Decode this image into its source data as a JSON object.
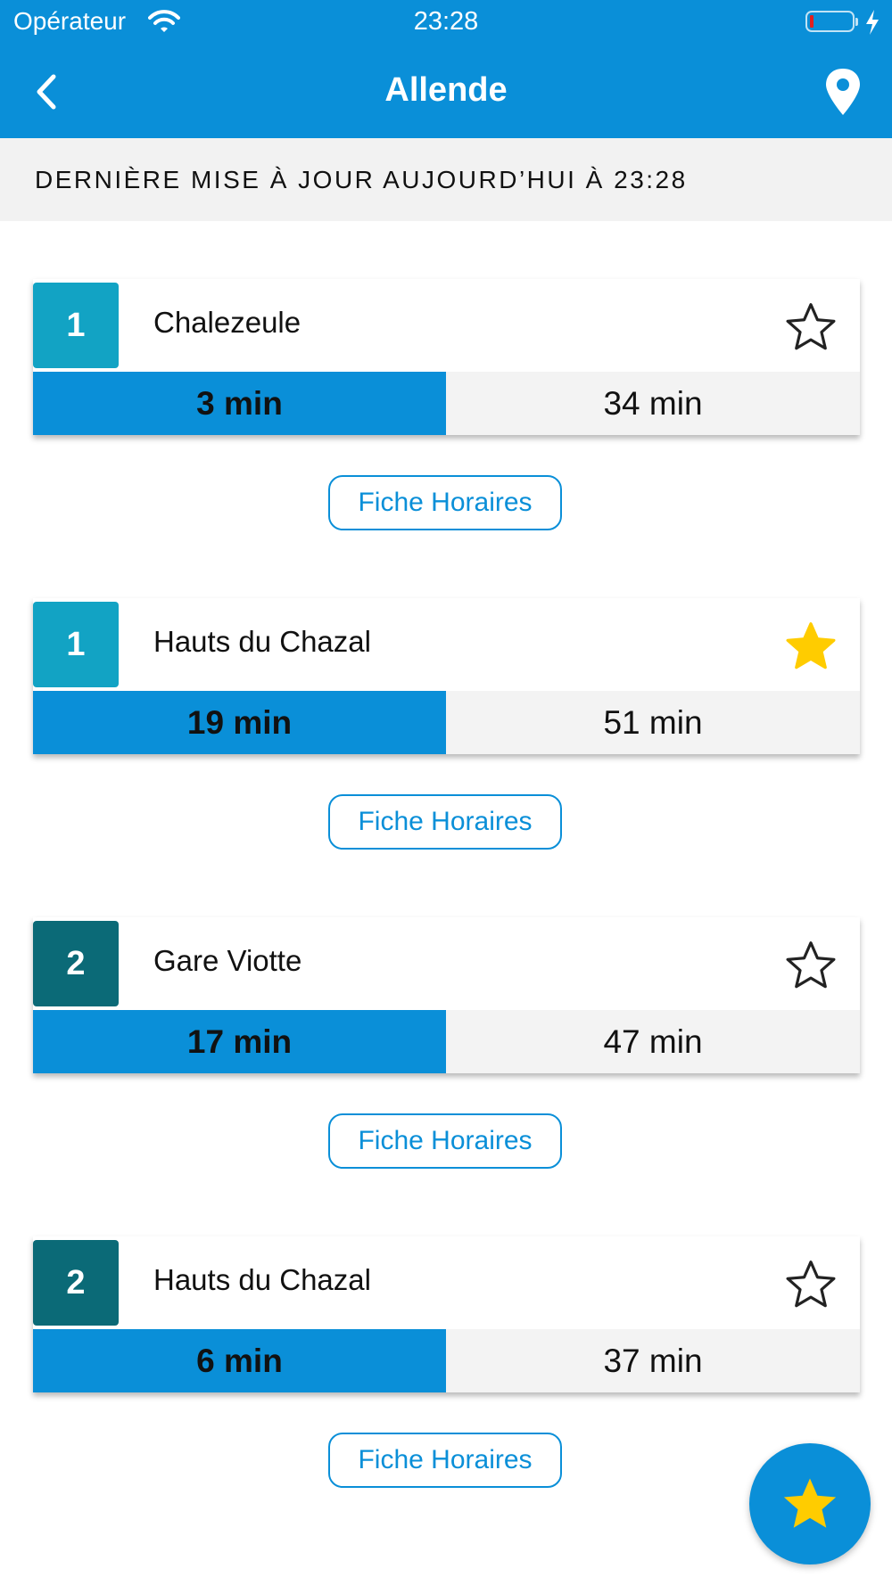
{
  "status_bar": {
    "carrier": "Opérateur",
    "time": "23:28"
  },
  "nav": {
    "title": "Allende",
    "back_icon": "chevron-left-icon",
    "map_icon": "map-pin-icon"
  },
  "last_update": "DERNIÈRE MISE À JOUR AUJOURD’HUI À 23:28",
  "departures": [
    {
      "line": "1",
      "line_color": "#12a3c4",
      "destination": "Chalezeule",
      "next": "3 min",
      "following": "34 min",
      "favorite": false,
      "button": "Fiche Horaires"
    },
    {
      "line": "1",
      "line_color": "#12a3c4",
      "destination": "Hauts du Chazal",
      "next": "19 min",
      "following": "51 min",
      "favorite": true,
      "button": "Fiche Horaires"
    },
    {
      "line": "2",
      "line_color": "#0b6a77",
      "destination": "Gare Viotte",
      "next": "17 min",
      "following": "47 min",
      "favorite": false,
      "button": "Fiche Horaires"
    },
    {
      "line": "2",
      "line_color": "#0b6a77",
      "destination": "Hauts du Chazal",
      "next": "6 min",
      "following": "37 min",
      "favorite": false,
      "button": "Fiche Horaires"
    }
  ],
  "colors": {
    "primary": "#0a8fd8",
    "favorite_star": "#ffcc00",
    "line_1": "#12a3c4",
    "line_2": "#0b6a77"
  },
  "fab_icon": "star-filled-icon"
}
